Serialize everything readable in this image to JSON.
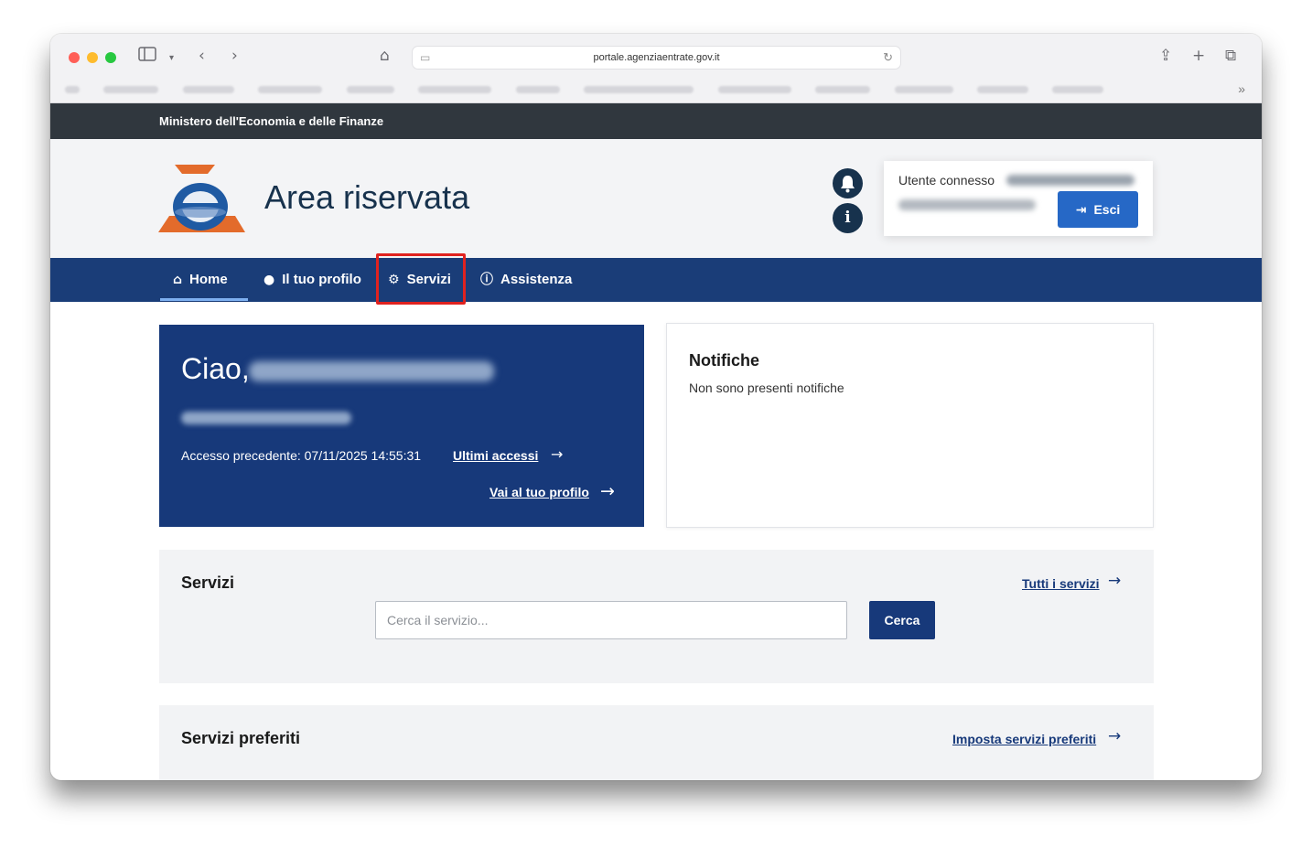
{
  "browser": {
    "url": "portale.agenziaentrate.gov.it",
    "icons": {
      "sidebar": "sidebar-icon",
      "back": "chevron-left-icon",
      "forward": "chevron-right-icon",
      "home": "home-icon",
      "reload": "reload-icon",
      "share": "share-icon",
      "new_tab": "plus-icon",
      "tabs": "tabs-icon"
    }
  },
  "ministry": {
    "label": "Ministero dell'Economia e delle Finanze"
  },
  "header": {
    "title": "Area riservata",
    "user_label": "Utente connesso",
    "logout_label": "Esci"
  },
  "nav": {
    "items": [
      {
        "label": "Home",
        "icon": "home-icon"
      },
      {
        "label": "Il tuo profilo",
        "icon": "user-icon"
      },
      {
        "label": "Servizi",
        "icon": "services-icon"
      },
      {
        "label": "Assistenza",
        "icon": "info-icon"
      }
    ],
    "active": "Home"
  },
  "welcome": {
    "greeting": "Ciao,",
    "previous_access": "Accesso precedente: 07/11/2025 14:55:31",
    "last_access_link": "Ultimi accessi",
    "profile_link": "Vai al tuo profilo"
  },
  "notifications": {
    "title": "Notifiche",
    "empty_text": "Non sono presenti notifiche"
  },
  "services": {
    "title": "Servizi",
    "all_link": "Tutti i servizi",
    "search_placeholder": "Cerca il servizio...",
    "search_button": "Cerca"
  },
  "favorites": {
    "title": "Servizi preferiti",
    "set_link": "Imposta servizi preferiti"
  },
  "colors": {
    "nav_bg": "#1a3d78",
    "brand_text": "#17324d",
    "primary_button": "#2668c6",
    "highlight": "#e0221f"
  }
}
